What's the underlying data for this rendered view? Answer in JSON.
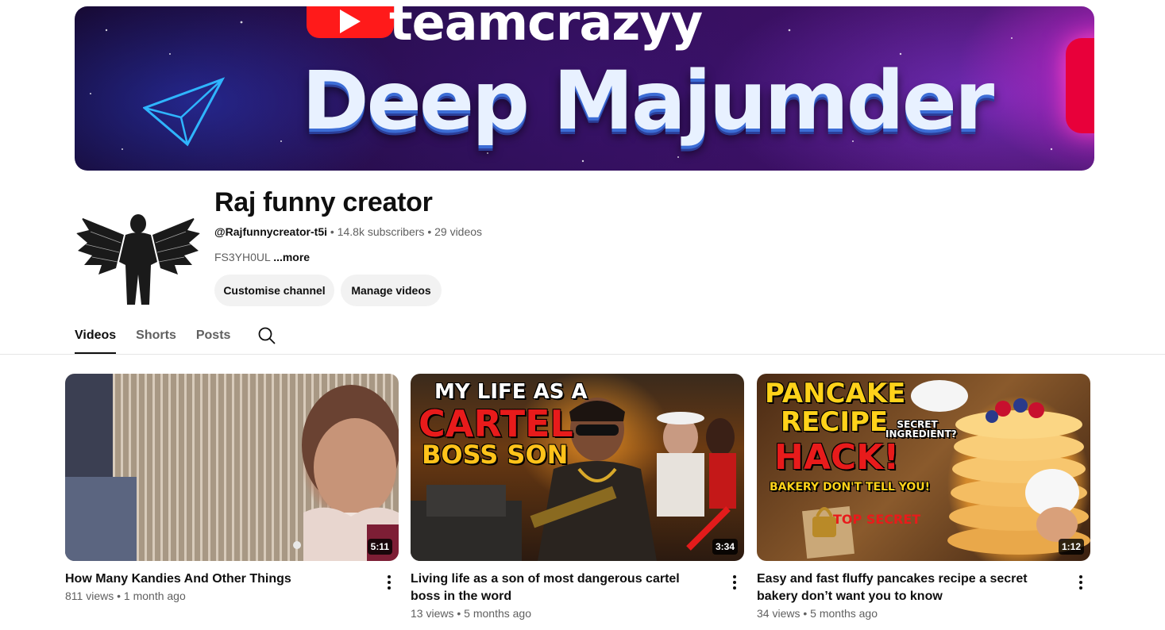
{
  "banner": {
    "brand": "teamcrazyy",
    "headline": "Deep Majumder"
  },
  "channel": {
    "name": "Raj funny creator",
    "handle": "@Rajfunnycreator-t5i",
    "subscribers": "14.8k subscribers",
    "videos_count": "29 videos",
    "separator": "•",
    "description": "FS3YH0UL",
    "more_label": "...more",
    "buttons": {
      "customise": "Customise channel",
      "manage": "Manage videos"
    }
  },
  "tabs": [
    {
      "label": "Videos",
      "active": true
    },
    {
      "label": "Shorts",
      "active": false
    },
    {
      "label": "Posts",
      "active": false
    }
  ],
  "videos": [
    {
      "title": "How Many Kandies And Other Things",
      "views": "811 views",
      "age": "1 month ago",
      "duration": "5:11"
    },
    {
      "title": "Living life as a son of most dangerous cartel boss in the word",
      "views": "13 views",
      "age": "5 months ago",
      "duration": "3:34",
      "thumb_text": [
        "MY LIFE AS A",
        "CARTEL",
        "BOSS SON"
      ]
    },
    {
      "title": "Easy and fast fluffy pancakes recipe a secret bakery don’t want you to know",
      "views": "34 views",
      "age": "5 months ago",
      "duration": "1:12",
      "thumb_text": [
        "PANCAKE",
        "RECIPE",
        "HACK!",
        "SECRET INGREDIENT?",
        "BAKERY DON'T TELL YOU!",
        "TOP SECRET"
      ]
    }
  ],
  "colors": {
    "text_primary": "#0f0f0f",
    "text_secondary": "#606060",
    "button_bg": "#f2f2f2",
    "divider": "#e5e5e5"
  }
}
